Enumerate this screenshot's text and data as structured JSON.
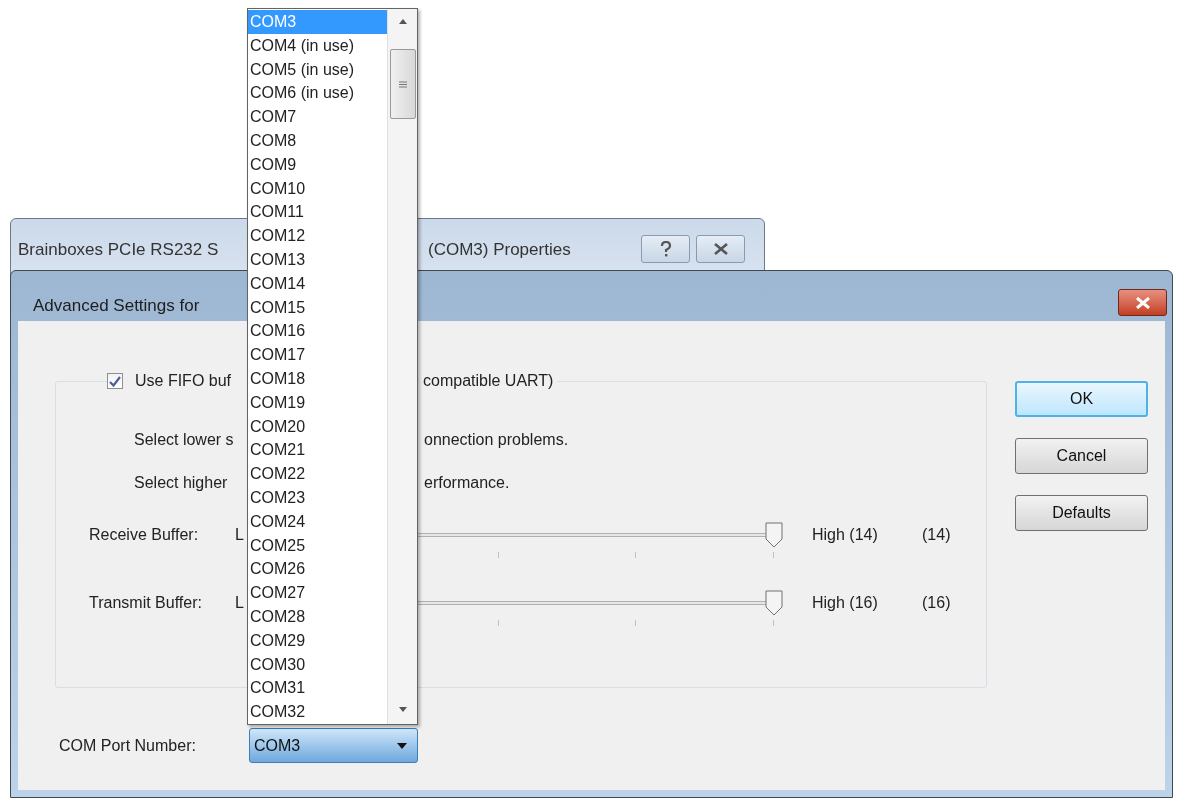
{
  "back_window": {
    "title_left": "Brainboxes PCIe RS232 S",
    "title_right": "(COM3) Properties"
  },
  "dialog": {
    "title": "Advanced Settings for"
  },
  "fifo": {
    "checked": true,
    "label_left": "Use FIFO buf",
    "label_right": "compatible UART)"
  },
  "hints": [
    {
      "left": "Select lower s",
      "right": "onnection problems."
    },
    {
      "left": "Select higher",
      "right": "erformance."
    }
  ],
  "sliders": [
    {
      "label": "Receive Buffer:",
      "low": "L",
      "level": 1,
      "value_label": "High (14)",
      "reading": "(14)"
    },
    {
      "label": "Transmit Buffer:",
      "low": "L",
      "level": 1,
      "value_label": "High (16)",
      "reading": "(16)"
    }
  ],
  "buttons": [
    {
      "label": "OK",
      "default": true
    },
    {
      "label": "Cancel",
      "default": false
    },
    {
      "label": "Defaults",
      "default": false
    }
  ],
  "com_port": {
    "label": "COM Port Number:",
    "value": "COM3",
    "expanded": true,
    "options": [
      {
        "label": "COM3",
        "selected": true
      },
      {
        "label": "COM4 (in use)",
        "selected": false
      },
      {
        "label": "COM5 (in use)",
        "selected": false
      },
      {
        "label": "COM6 (in use)",
        "selected": false
      },
      {
        "label": "COM7",
        "selected": false
      },
      {
        "label": "COM8",
        "selected": false
      },
      {
        "label": "COM9",
        "selected": false
      },
      {
        "label": "COM10",
        "selected": false
      },
      {
        "label": "COM11",
        "selected": false
      },
      {
        "label": "COM12",
        "selected": false
      },
      {
        "label": "COM13",
        "selected": false
      },
      {
        "label": "COM14",
        "selected": false
      },
      {
        "label": "COM15",
        "selected": false
      },
      {
        "label": "COM16",
        "selected": false
      },
      {
        "label": "COM17",
        "selected": false
      },
      {
        "label": "COM18",
        "selected": false
      },
      {
        "label": "COM19",
        "selected": false
      },
      {
        "label": "COM20",
        "selected": false
      },
      {
        "label": "COM21",
        "selected": false
      },
      {
        "label": "COM22",
        "selected": false
      },
      {
        "label": "COM23",
        "selected": false
      },
      {
        "label": "COM24",
        "selected": false
      },
      {
        "label": "COM25",
        "selected": false
      },
      {
        "label": "COM26",
        "selected": false
      },
      {
        "label": "COM27",
        "selected": false
      },
      {
        "label": "COM28",
        "selected": false
      },
      {
        "label": "COM29",
        "selected": false
      },
      {
        "label": "COM30",
        "selected": false
      },
      {
        "label": "COM31",
        "selected": false
      },
      {
        "label": "COM32",
        "selected": false
      }
    ]
  }
}
